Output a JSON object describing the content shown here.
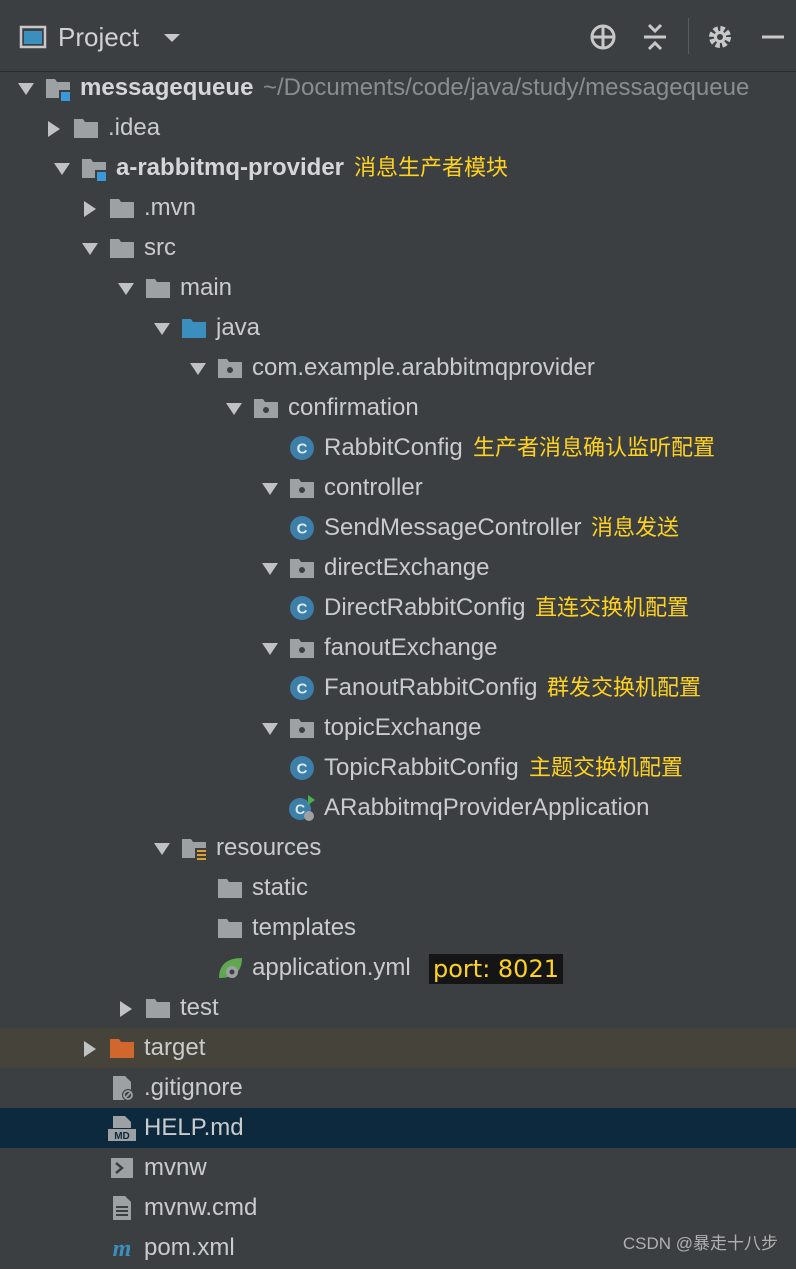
{
  "header": {
    "title": "Project",
    "icons": [
      "project-window-icon",
      "chevron-down-icon",
      "locate-icon",
      "collapse-all-icon",
      "gear-icon",
      "minimize-icon"
    ]
  },
  "colors": {
    "background": "#3c3f41",
    "folder": "#9ea1a3",
    "source_folder": "#3a8fbf",
    "class_icon": "#3c7fa9",
    "excluded_folder": "#d2672d",
    "annotation": "#ffd21f",
    "selected_row": "#0d293e"
  },
  "tree": [
    {
      "arrow": "down",
      "icon": "module-folder",
      "label": "messagequeue",
      "bold": true,
      "path": "~/Documents/code/java/study/messagequeue"
    },
    {
      "arrow": "right",
      "icon": "folder",
      "label": ".idea"
    },
    {
      "arrow": "down",
      "icon": "module-folder",
      "label": "a-rabbitmq-provider",
      "bold": true,
      "note": "消息生产者模块"
    },
    {
      "arrow": "right",
      "icon": "folder",
      "label": ".mvn"
    },
    {
      "arrow": "down",
      "icon": "folder",
      "label": "src"
    },
    {
      "arrow": "down",
      "icon": "folder",
      "label": "main"
    },
    {
      "arrow": "down",
      "icon": "source-folder",
      "label": "java"
    },
    {
      "arrow": "down",
      "icon": "package",
      "label": "com.example.arabbitmqprovider"
    },
    {
      "arrow": "down",
      "icon": "package",
      "label": "confirmation"
    },
    {
      "arrow": "",
      "icon": "class",
      "label": "RabbitConfig",
      "note": "生产者消息确认监听配置"
    },
    {
      "arrow": "down",
      "icon": "package",
      "label": "controller"
    },
    {
      "arrow": "",
      "icon": "class",
      "label": "SendMessageController",
      "note": "消息发送"
    },
    {
      "arrow": "down",
      "icon": "package",
      "label": "directExchange"
    },
    {
      "arrow": "",
      "icon": "class",
      "label": "DirectRabbitConfig",
      "note": "直连交换机配置"
    },
    {
      "arrow": "down",
      "icon": "package",
      "label": "fanoutExchange"
    },
    {
      "arrow": "",
      "icon": "class",
      "label": "FanoutRabbitConfig",
      "note": "群发交换机配置"
    },
    {
      "arrow": "down",
      "icon": "package",
      "label": "topicExchange"
    },
    {
      "arrow": "",
      "icon": "class",
      "label": "TopicRabbitConfig",
      "note": "主题交换机配置"
    },
    {
      "arrow": "",
      "icon": "spring-boot-class",
      "label": "ARabbitmqProviderApplication"
    },
    {
      "arrow": "down",
      "icon": "resources-folder",
      "label": "resources"
    },
    {
      "arrow": "",
      "icon": "folder",
      "label": "static"
    },
    {
      "arrow": "",
      "icon": "folder",
      "label": "templates"
    },
    {
      "arrow": "",
      "icon": "spring-yml",
      "label": "application.yml",
      "note": "port: 8021",
      "note_boxed": true
    },
    {
      "arrow": "right",
      "icon": "folder",
      "label": "test"
    },
    {
      "arrow": "right",
      "icon": "excluded-folder",
      "label": "target",
      "highlight": "olive"
    },
    {
      "arrow": "",
      "icon": "gitignore-file",
      "label": ".gitignore"
    },
    {
      "arrow": "",
      "icon": "markdown-file",
      "label": "HELP.md",
      "highlight": "dark"
    },
    {
      "arrow": "",
      "icon": "shell-file",
      "label": "mvnw"
    },
    {
      "arrow": "",
      "icon": "text-file",
      "label": "mvnw.cmd"
    },
    {
      "arrow": "",
      "icon": "maven-file",
      "label": "pom.xml"
    }
  ],
  "watermark": "CSDN @暴走十八步"
}
